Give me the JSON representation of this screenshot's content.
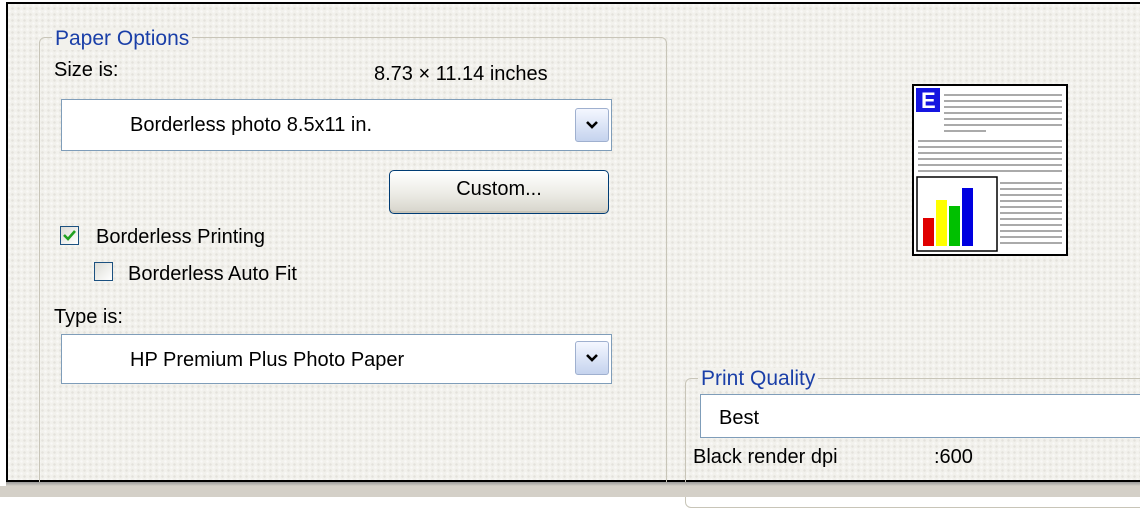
{
  "paper_options": {
    "title": "Paper Options",
    "size_label": "Size is:",
    "size_dimensions": "8.73 × 11.14 inches",
    "size_value": "Borderless photo 8.5x11 in.",
    "custom_button": "Custom...",
    "borderless_printing": {
      "label": "Borderless Printing",
      "checked": true
    },
    "borderless_auto_fit": {
      "label": "Borderless Auto Fit",
      "checked": false
    },
    "type_label": "Type is:",
    "type_value": "HP Premium Plus Photo Paper"
  },
  "preview": {
    "letter": "E",
    "bar_colors": [
      "#e00000",
      "#ffff00",
      "#00c000",
      "#0000e0"
    ]
  },
  "print_quality": {
    "title": "Print Quality",
    "value": "Best",
    "dpi_label": "Black render dpi",
    "dpi_value": ":600"
  },
  "colors": {
    "group_title": "#1a3fa8",
    "checkmark": "#21a121",
    "frame_bg": "#f2f1ec"
  }
}
